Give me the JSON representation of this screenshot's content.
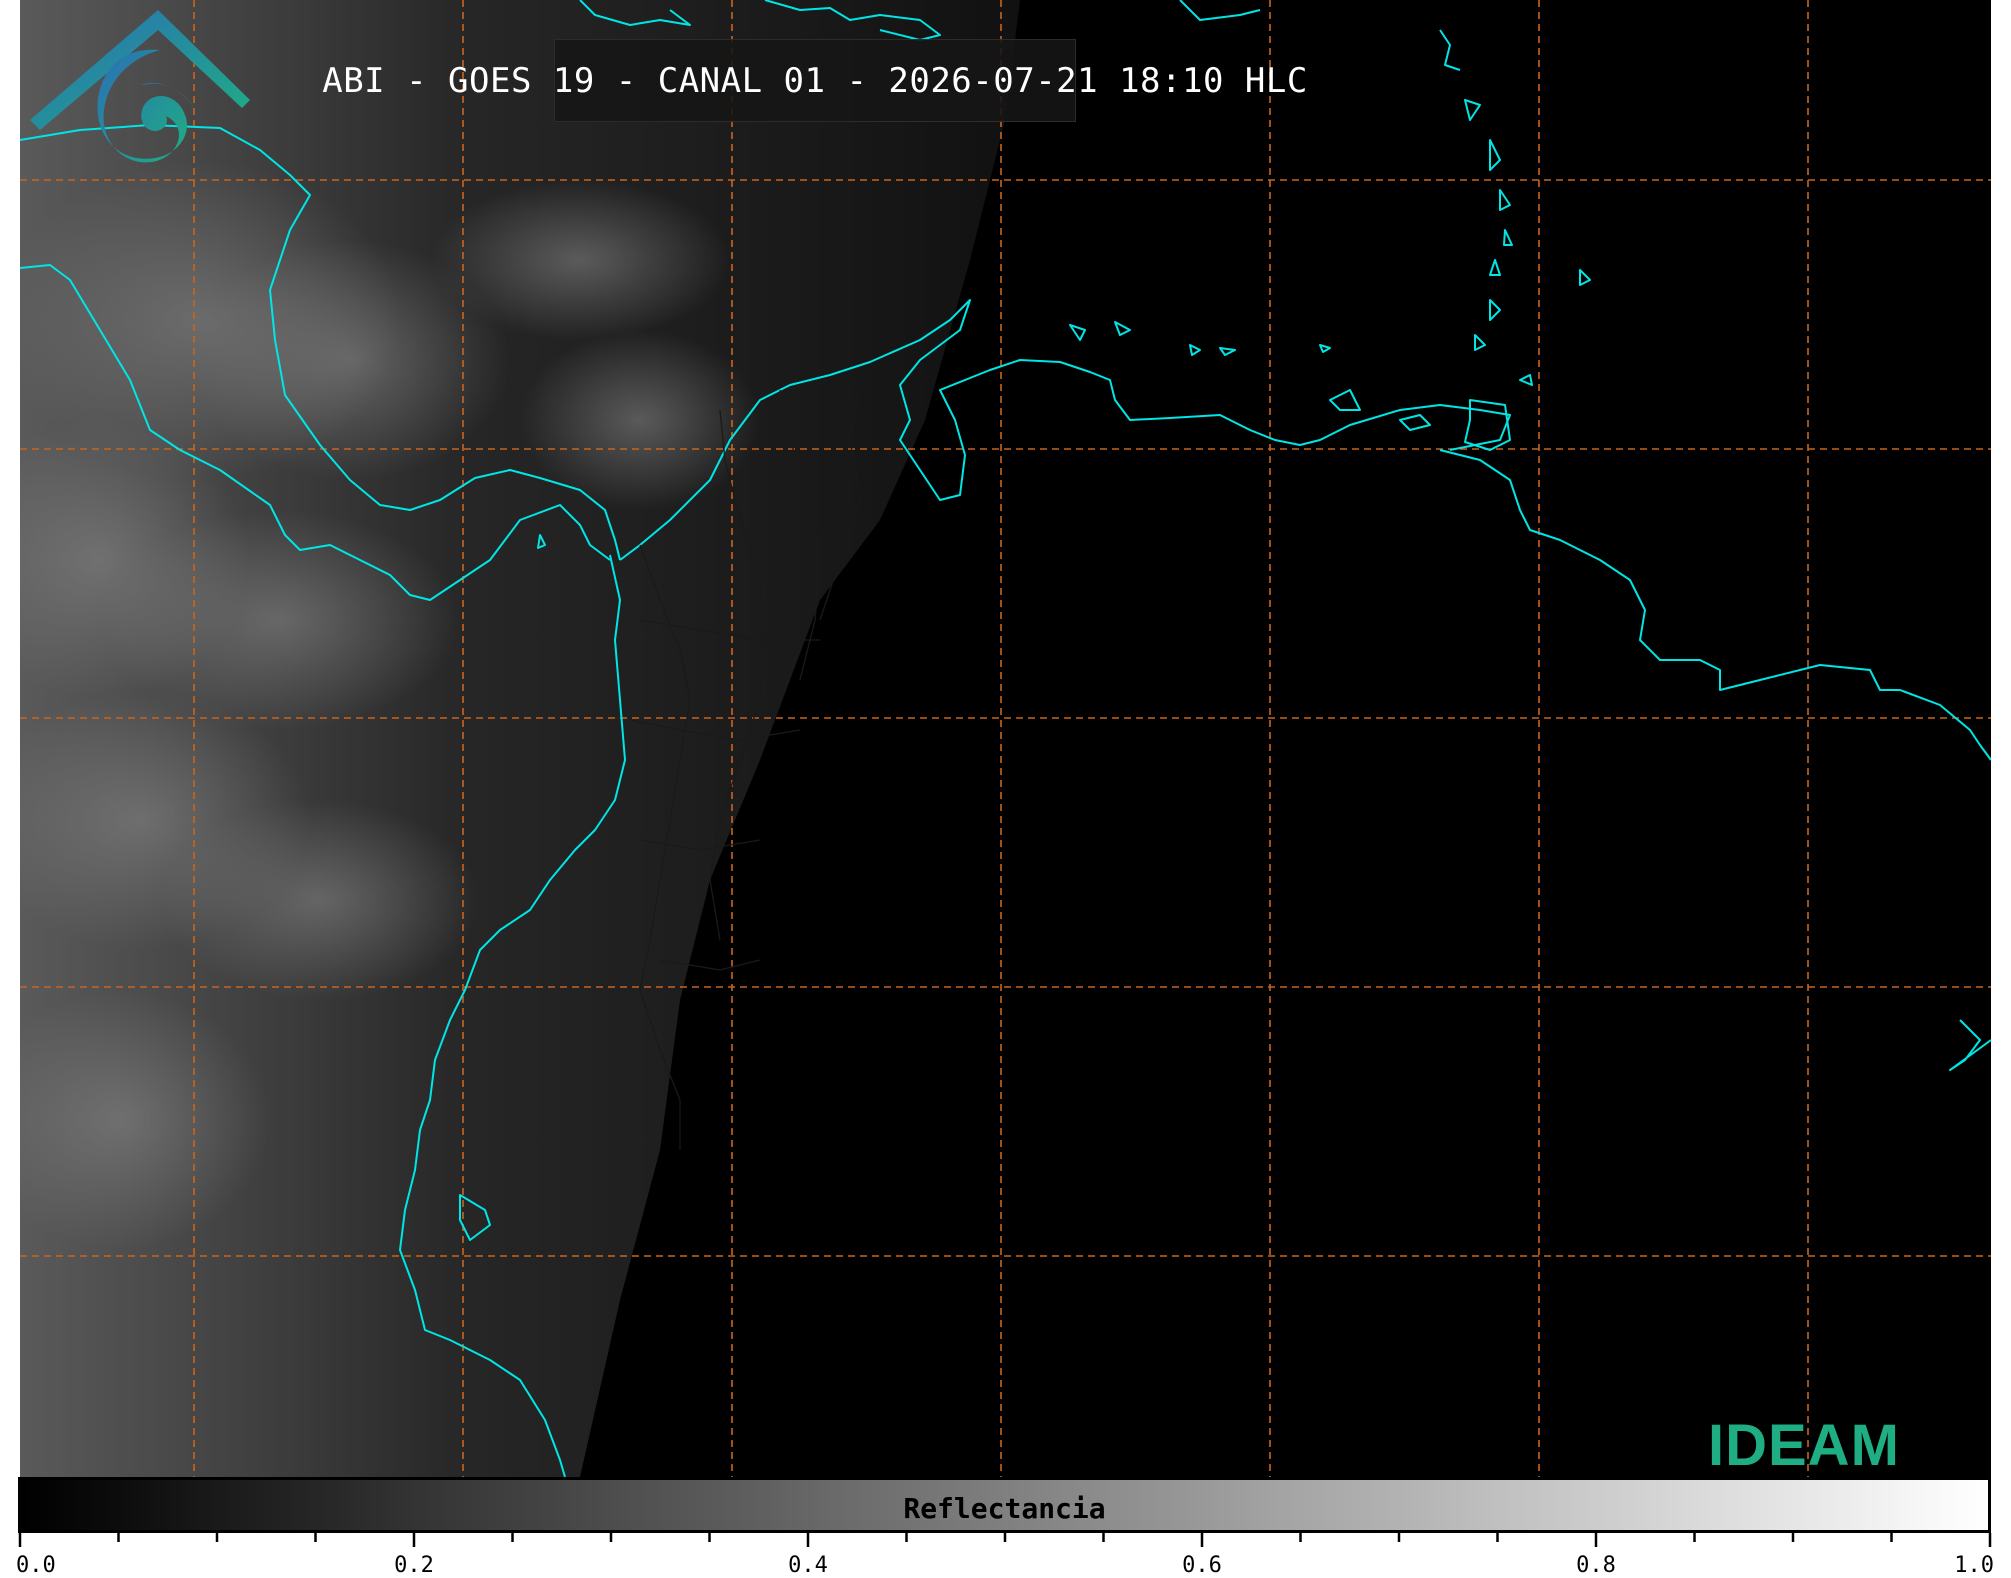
{
  "title": "ABI - GOES 19 - CANAL 01 - 2026-07-21 18:10 HLC",
  "colorbar": {
    "label": "Reflectancia",
    "min": 0.0,
    "max": 1.0,
    "tick_labels": [
      "0.0",
      "0.2",
      "0.4",
      "0.6",
      "0.8",
      "1.0"
    ],
    "colormap": "grayscale"
  },
  "logo": {
    "text": "IDEAM"
  },
  "colors": {
    "coastline": "#00e5e5",
    "gridlines": "#c8651f",
    "background": "#000000",
    "logo_text": "#1fae83",
    "logo_accent": "#2a6fb5"
  }
}
